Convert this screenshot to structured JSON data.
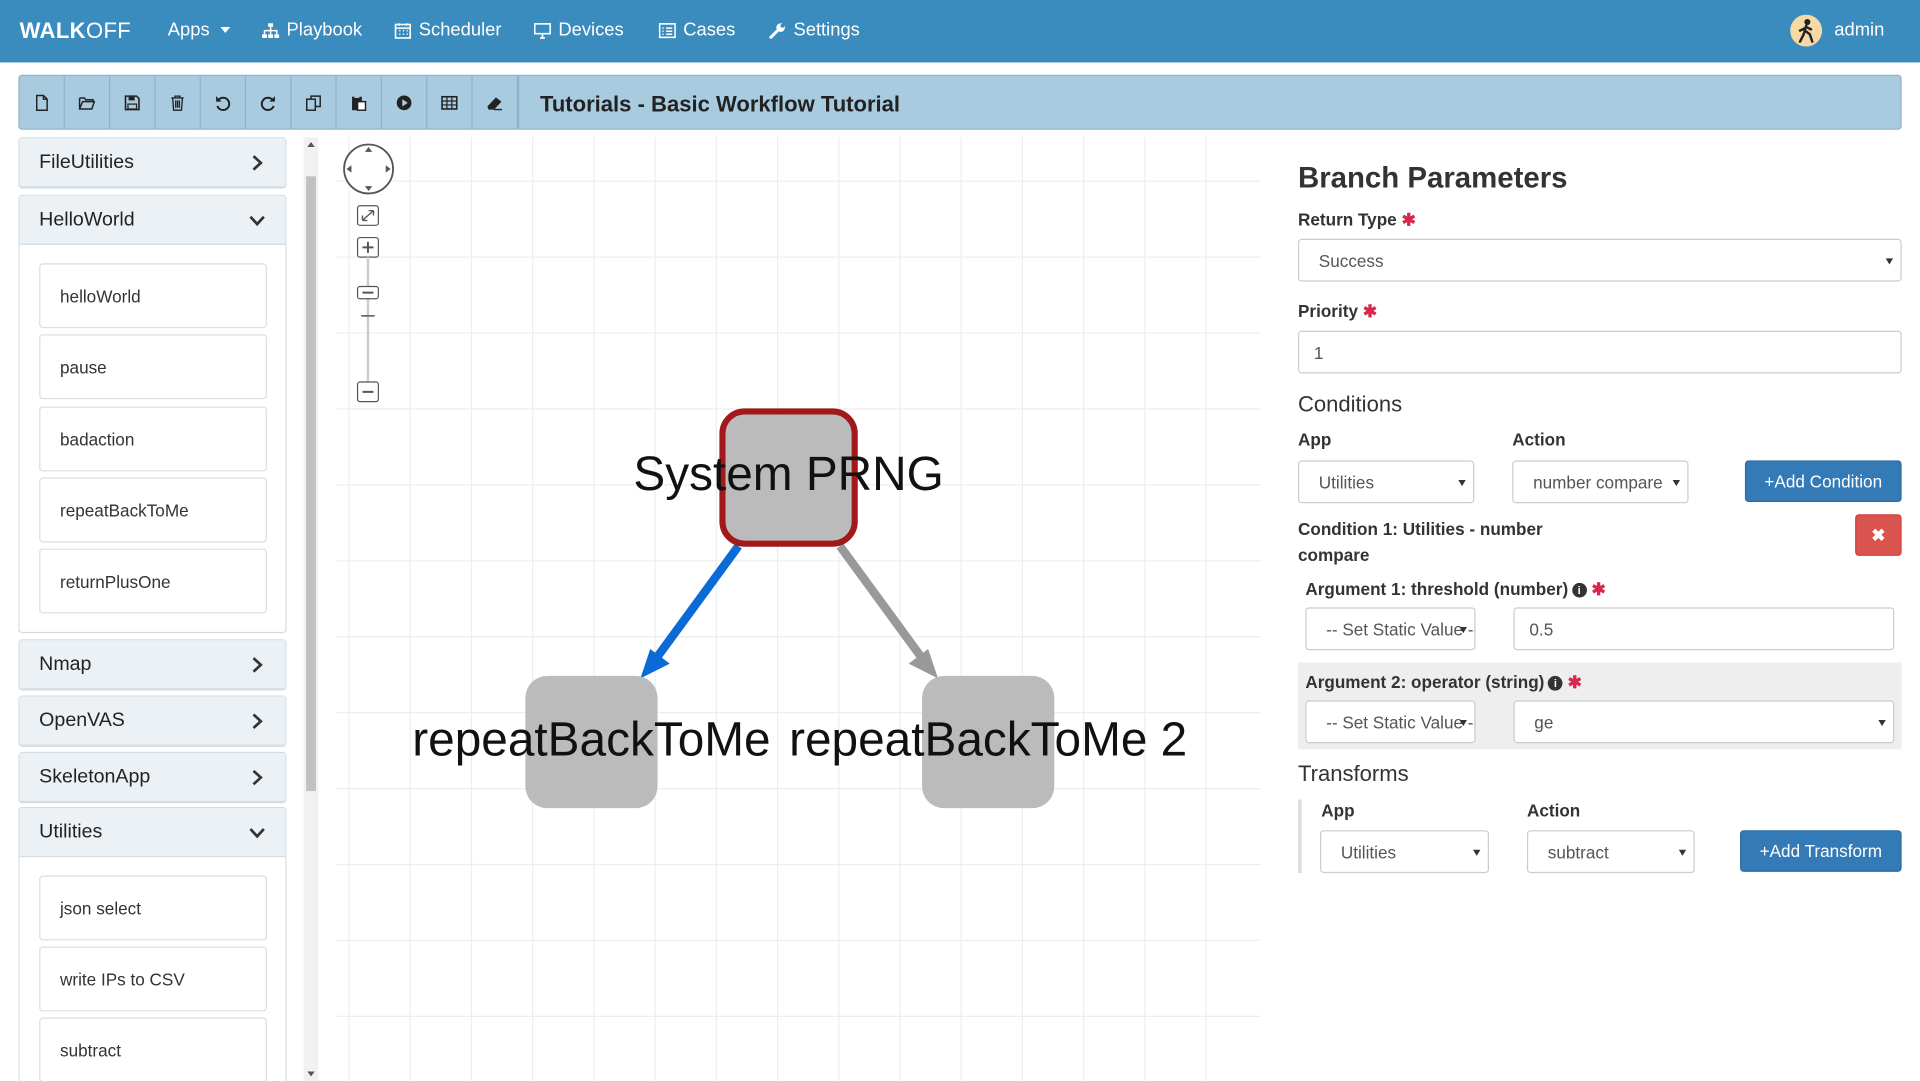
{
  "nav": {
    "brand_bold": "WALK",
    "brand_rest": "OFF",
    "items": [
      "Apps",
      "Playbook",
      "Scheduler",
      "Devices",
      "Cases",
      "Settings"
    ],
    "user": "admin"
  },
  "toolbar": {
    "title": "Tutorials - Basic Workflow Tutorial",
    "buttons": [
      "new-file-icon",
      "open-folder-icon",
      "save-icon",
      "delete-icon",
      "undo-icon",
      "redo-icon",
      "copy-icon",
      "paste-icon",
      "execute-icon",
      "results-table-icon",
      "clear-eraser-icon"
    ]
  },
  "sidebar": {
    "apps": [
      {
        "name": "FileUtilities",
        "expanded": false
      },
      {
        "name": "HelloWorld",
        "expanded": true,
        "actions": [
          "helloWorld",
          "pause",
          "badaction",
          "repeatBackToMe",
          "returnPlusOne"
        ]
      },
      {
        "name": "Nmap",
        "expanded": false
      },
      {
        "name": "OpenVAS",
        "expanded": false
      },
      {
        "name": "SkeletonApp",
        "expanded": false
      },
      {
        "name": "Utilities",
        "expanded": true,
        "actions": [
          "json select",
          "write IPs to CSV",
          "subtract"
        ]
      }
    ]
  },
  "graph": {
    "nodes": [
      {
        "label": "System PRNG",
        "selected": true
      },
      {
        "label": "repeatBackToMe",
        "selected": false
      },
      {
        "label": "repeatBackToMe 2",
        "selected": false
      }
    ],
    "edges": [
      {
        "from": "System PRNG",
        "to": "repeatBackToMe",
        "selected": true
      },
      {
        "from": "System PRNG",
        "to": "repeatBackToMe 2",
        "selected": false
      }
    ],
    "colors": {
      "node": "#bbbbbb",
      "selected_border": "#a1191a",
      "selected_edge": "#0b6bd6",
      "edge": "#999999"
    }
  },
  "branch": {
    "title": "Branch Parameters",
    "return_type_label": "Return Type",
    "return_type_value": "Success",
    "priority_label": "Priority",
    "priority_value": "1",
    "conditions_heading": "Conditions",
    "app_label": "App",
    "action_label": "Action",
    "condition_app": "Utilities",
    "condition_action": "number compare",
    "add_condition": "+Add Condition",
    "condition1_title_line1": "Condition 1: Utilities - number",
    "condition1_title_line2": "compare",
    "remove_symbol": "✖",
    "arg1_label": "Argument 1: threshold (number)",
    "arg1_source": "-- Set Static Value --",
    "arg1_value": "0.5",
    "arg2_label": "Argument 2: operator (string)",
    "arg2_source": "-- Set Static Value --",
    "arg2_value": "ge",
    "transforms_heading": "Transforms",
    "transform_app_label": "App",
    "transform_action_label": "Action",
    "transform_app": "Utilities",
    "transform_action": "subtract",
    "add_transform": "+Add Transform",
    "required_mark": "✱"
  }
}
